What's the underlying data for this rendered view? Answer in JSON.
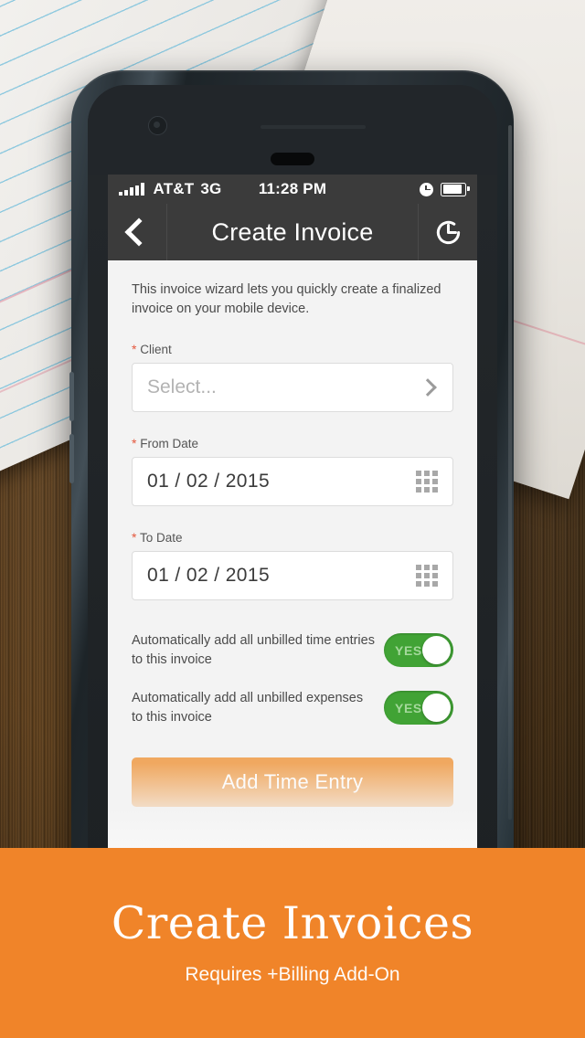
{
  "statusbar": {
    "signal_icon": "signal-bars-icon",
    "carrier": "AT&T",
    "network": "3G",
    "time": "11:28 PM",
    "clock_icon": "alarm-clock-icon",
    "battery_icon": "battery-full-icon"
  },
  "navbar": {
    "back_icon": "chevron-left-icon",
    "title": "Create Invoice",
    "action_icon": "clock-icon"
  },
  "form": {
    "intro": "This invoice wizard lets you quickly create a finalized invoice on your mobile device.",
    "required_marker": "*",
    "client": {
      "label": "Client",
      "placeholder": "Select...",
      "chevron_icon": "chevron-right-icon"
    },
    "from_date": {
      "label": "From Date",
      "value": "01 / 02 / 2015",
      "icon": "calendar-grid-icon"
    },
    "to_date": {
      "label": "To Date",
      "value": "01 / 02 / 2015",
      "icon": "calendar-grid-icon"
    },
    "toggles": [
      {
        "text": "Automatically add all unbilled time entries to this invoice",
        "state": "YES"
      },
      {
        "text": "Automatically add all unbilled expenses to this invoice",
        "state": "YES"
      }
    ],
    "primary_button": "Add Time Entry"
  },
  "banner": {
    "title": "Create Invoices",
    "subtitle": "Requires +Billing Add-On",
    "background_color": "#f08429",
    "text_color": "#ffffff"
  },
  "colors": {
    "accent_orange": "#f08429",
    "toggle_green": "#41a335",
    "nav_dark": "#3b3b3b",
    "required_red": "#e4573d",
    "button_orange_faded": "#f0a860"
  }
}
